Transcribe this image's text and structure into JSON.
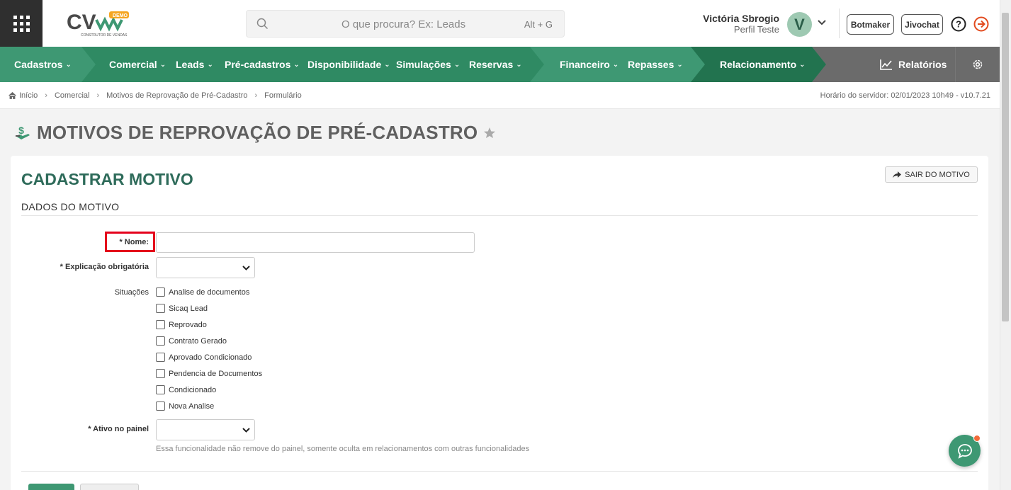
{
  "search": {
    "placeholder": "O que procura? Ex: Leads",
    "shortcut": "Alt + G"
  },
  "user": {
    "name": "Victória Sbrogio",
    "profile": "Perfil Teste",
    "initial": "V"
  },
  "header_buttons": {
    "botmaker": "Botmaker",
    "jivochat": "Jivochat"
  },
  "nav": {
    "items": [
      "Cadastros",
      "Comercial",
      "Leads",
      "Pré-cadastros",
      "Disponibilidade",
      "Simulações",
      "Reservas",
      "Financeiro",
      "Repasses",
      "Relacionamento"
    ],
    "reports": "Relatórios",
    "colors": {
      "base": "#3e9873",
      "mid": "#2f8a63",
      "dark": "#22734f",
      "gray": "#6b6b6b"
    }
  },
  "breadcrumb": {
    "items": [
      "Início",
      "Comercial",
      "Motivos de Reprovação de Pré-Cadastro",
      "Formulário"
    ],
    "server": "Horário do servidor: 02/01/2023 10h49 - v10.7.21"
  },
  "page": {
    "title": "MOTIVOS DE REPROVAÇÃO DE PRÉ-CADASTRO"
  },
  "form": {
    "title": "CADASTRAR MOTIVO",
    "exit_button": "SAIR DO MOTIVO",
    "section": "DADOS DO MOTIVO",
    "labels": {
      "nome": "* Nome:",
      "explicacao": "* Explicação obrigatória",
      "situacoes": "Situações",
      "ativo": "* Ativo no painel"
    },
    "situacoes": [
      "Analise de documentos",
      "Sicaq Lead",
      "Reprovado",
      "Contrato Gerado",
      "Aprovado Condicionado",
      "Pendencia de Documentos",
      "Condicionado",
      "Nova Analise"
    ],
    "note": "Essa funcionalidade não remove do painel, somente oculta em relacionamentos com outras funcionalidades"
  },
  "logo": {
    "text": "CV",
    "badge": "DEMO",
    "tagline": "CONSTRUTOR DE VENDAS"
  }
}
